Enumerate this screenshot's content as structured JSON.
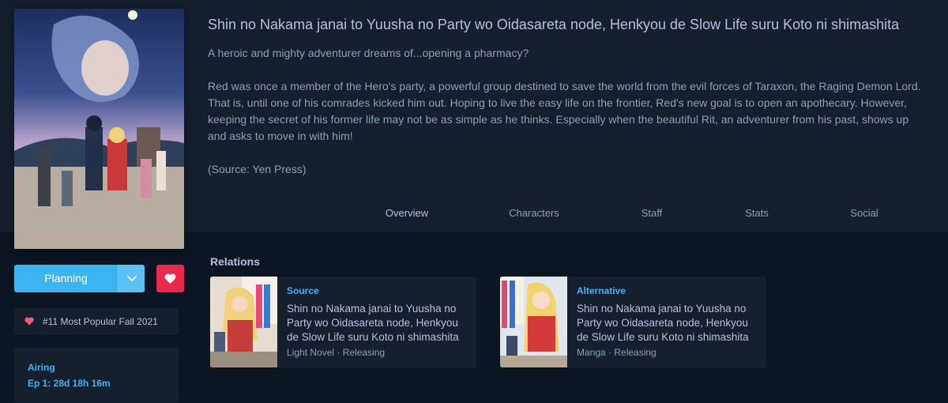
{
  "media": {
    "title": "Shin no Nakama janai to Yuusha no Party wo Oidasareta node, Henkyou de Slow Life suru Koto ni shimashita",
    "tagline": "A heroic and mighty adventurer dreams of...opening a pharmacy?",
    "description": "Red was once a member of the Hero's party, a powerful group destined to save the world from the evil forces of Taraxon, the Raging Demon Lord. That is, until one of his comrades kicked him out. Hoping to live the easy life on the frontier, Red's new goal is to open an apothecary. However, keeping the secret of his former life may not be as simple as he thinks. Especially when the beautiful Rit, an adventurer from his past, shows up and asks to move in with him!",
    "source_note": "(Source: Yen Press)"
  },
  "tabs": [
    {
      "label": "Overview",
      "active": true
    },
    {
      "label": "Characters",
      "active": false
    },
    {
      "label": "Staff",
      "active": false
    },
    {
      "label": "Stats",
      "active": false
    },
    {
      "label": "Social",
      "active": false
    }
  ],
  "actions": {
    "list_status_label": "Planning",
    "dropdown_icon": "chevron-down-icon",
    "favourite_icon": "heart-icon"
  },
  "rankings": [
    {
      "icon": "heart-icon",
      "text": "#11 Most Popular Fall 2021"
    }
  ],
  "airing": {
    "label": "Airing",
    "value": "Ep 1: 28d 18h 16m"
  },
  "relations": {
    "heading": "Relations",
    "items": [
      {
        "type": "Source",
        "title": "Shin no Nakama janai to Yuusha no Party wo Oidasareta node, Henkyou de Slow Life suru Koto ni shimashita",
        "meta": "Light Novel · Releasing"
      },
      {
        "type": "Alternative",
        "title": "Shin no Nakama janai to Yuusha no Party wo Oidasareta node, Henkyou de Slow Life suru Koto ni shimashita",
        "meta": "Manga · Releasing"
      }
    ]
  },
  "colors": {
    "background": "#0b1622",
    "header_band": "#151f2e",
    "accent_blue": "#3db4f2",
    "favourite_red": "#ec294b",
    "text_primary": "#bcbedc",
    "text_secondary": "#8ba0b2"
  }
}
